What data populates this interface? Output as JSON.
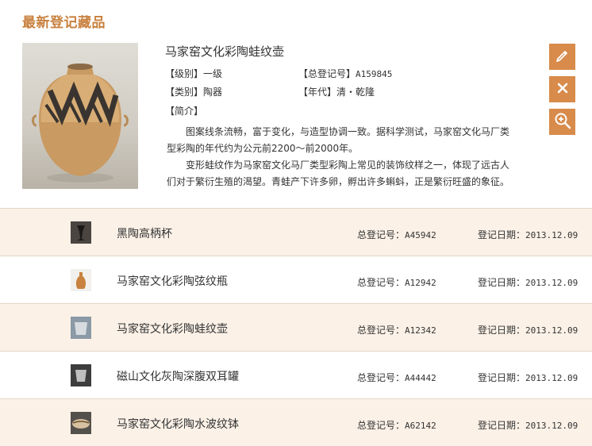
{
  "section": {
    "title": "最新登记藏品"
  },
  "featured": {
    "title": "马家窑文化彩陶蛙纹壶",
    "level_label": "【级别】",
    "level_value": "一级",
    "reg_label": "【总登记号】",
    "reg_value": "A159845",
    "category_label": "【类别】",
    "category_value": "陶器",
    "era_label": "【年代】",
    "era_value": "清・乾隆",
    "intro_label": "【简介】",
    "intro_p1": "图案线条流畅，富于变化，与造型协调一致。据科学测试，马家窑文化马厂类型彩陶的年代约为公元前2200～前2000年。",
    "intro_p2": "变形蛙纹作为马家窑文化马厂类型彩陶上常见的装饰纹样之一，体现了远古人们对于繁衍生殖的渴望。青蛙产下许多卵，孵出许多蝌蚪，正是繁衍旺盛的象征。"
  },
  "actions": {
    "edit": "edit-icon",
    "delete": "close-icon",
    "zoom": "zoom-in-icon"
  },
  "colors": {
    "accent": "#d88b4b",
    "title": "#c8803e",
    "row_alt": "#fbf1e7"
  },
  "list": [
    {
      "name": "黑陶高柄杯",
      "reg_label": "总登记号：",
      "reg": "A45942",
      "date_label": "登记日期：",
      "date": "2013.12.09"
    },
    {
      "name": "马家窑文化彩陶弦纹瓶",
      "reg_label": "总登记号：",
      "reg": "A12942",
      "date_label": "登记日期：",
      "date": "2013.12.09"
    },
    {
      "name": "马家窑文化彩陶蛙纹壶",
      "reg_label": "总登记号：",
      "reg": "A12342",
      "date_label": "登记日期：",
      "date": "2013.12.09"
    },
    {
      "name": "磁山文化灰陶深腹双耳罐",
      "reg_label": "总登记号：",
      "reg": "A44442",
      "date_label": "登记日期：",
      "date": "2013.12.09"
    },
    {
      "name": "马家窑文化彩陶水波纹钵",
      "reg_label": "总登记号：",
      "reg": "A62142",
      "date_label": "登记日期：",
      "date": "2013.12.09"
    }
  ]
}
